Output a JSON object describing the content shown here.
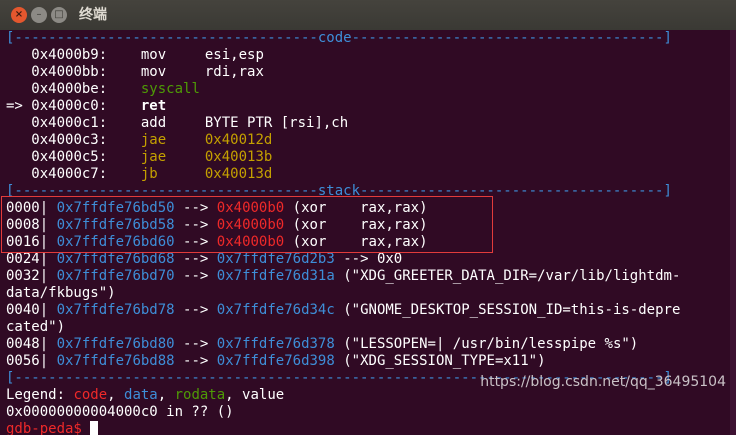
{
  "window": {
    "title": "终端",
    "close_icon": "×",
    "min_icon": "–",
    "max_icon": "□"
  },
  "code_header": "[------------------------------------code-------------------------------------]",
  "code": [
    {
      "pre": "   ",
      "addr": "0x4000b9:",
      "op": "mov",
      "args": "esi,esp"
    },
    {
      "pre": "   ",
      "addr": "0x4000bb:",
      "op": "mov",
      "args": "rdi,rax"
    },
    {
      "pre": "   ",
      "addr": "0x4000be:",
      "op": "syscall",
      "args": ""
    },
    {
      "pre": "=> ",
      "addr": "0x4000c0:",
      "op": "ret",
      "args": ""
    },
    {
      "pre": "   ",
      "addr": "0x4000c1:",
      "op": "add",
      "args": "BYTE PTR [rsi],ch"
    },
    {
      "pre": "   ",
      "addr": "0x4000c3:",
      "op": "jae",
      "args": "0x40012d"
    },
    {
      "pre": "   ",
      "addr": "0x4000c5:",
      "op": "jae",
      "args": "0x40013b"
    },
    {
      "pre": "   ",
      "addr": "0x4000c7:",
      "op": "jb",
      "args": "0x40013d"
    }
  ],
  "stack_header": "[------------------------------------stack------------------------------------]",
  "stack": [
    {
      "idx": "0000|",
      "addr": "0x7ffdfe76bd50",
      "arrow": "-->",
      "target": "0x4000b0",
      "rest": "(xor    rax,rax)"
    },
    {
      "idx": "0008|",
      "addr": "0x7ffdfe76bd58",
      "arrow": "-->",
      "target": "0x4000b0",
      "rest": "(xor    rax,rax)"
    },
    {
      "idx": "0016|",
      "addr": "0x7ffdfe76bd60",
      "arrow": "-->",
      "target": "0x4000b0",
      "rest": "(xor    rax,rax)"
    },
    {
      "idx": "0024|",
      "addr": "0x7ffdfe76bd68",
      "arrow": "-->",
      "target": "0x7ffdfe76d2b3",
      "rest": "--> 0x0"
    },
    {
      "idx": "0032|",
      "addr": "0x7ffdfe76bd70",
      "arrow": "-->",
      "target": "0x7ffdfe76d31a",
      "rest": "(\"XDG_GREETER_DATA_DIR=/var/lib/lightdm-"
    },
    {
      "cont": "data/fkbugs\")"
    },
    {
      "idx": "0040|",
      "addr": "0x7ffdfe76bd78",
      "arrow": "-->",
      "target": "0x7ffdfe76d34c",
      "rest": "(\"GNOME_DESKTOP_SESSION_ID=this-is-depre"
    },
    {
      "cont": "cated\")"
    },
    {
      "idx": "0048|",
      "addr": "0x7ffdfe76bd80",
      "arrow": "-->",
      "target": "0x7ffdfe76d378",
      "rest": "(\"LESSOPEN=| /usr/bin/lesspipe %s\")"
    },
    {
      "idx": "0056|",
      "addr": "0x7ffdfe76bd88",
      "arrow": "-->",
      "target": "0x7ffdfe76d398",
      "rest": "(\"XDG_SESSION_TYPE=x11\")"
    }
  ],
  "end_divider": "[-----------------------------------------------------------------------------]",
  "legend": {
    "prefix": "Legend: ",
    "code": "code",
    "data": "data",
    "rodata": "rodata",
    "value": "value",
    "sep": ", "
  },
  "location_line": "0x00000000004000c0 in ?? ()",
  "prompt": "gdb-peda$ ",
  "watermark": "https://blog.csdn.net/qq_36495104",
  "colors": {
    "background": "#300a24",
    "code": "#ef2929",
    "data": "#3e8ed8",
    "rodata": "#4e9a06",
    "yellow": "#c4a000",
    "highlight_box": "#e23b3b"
  }
}
